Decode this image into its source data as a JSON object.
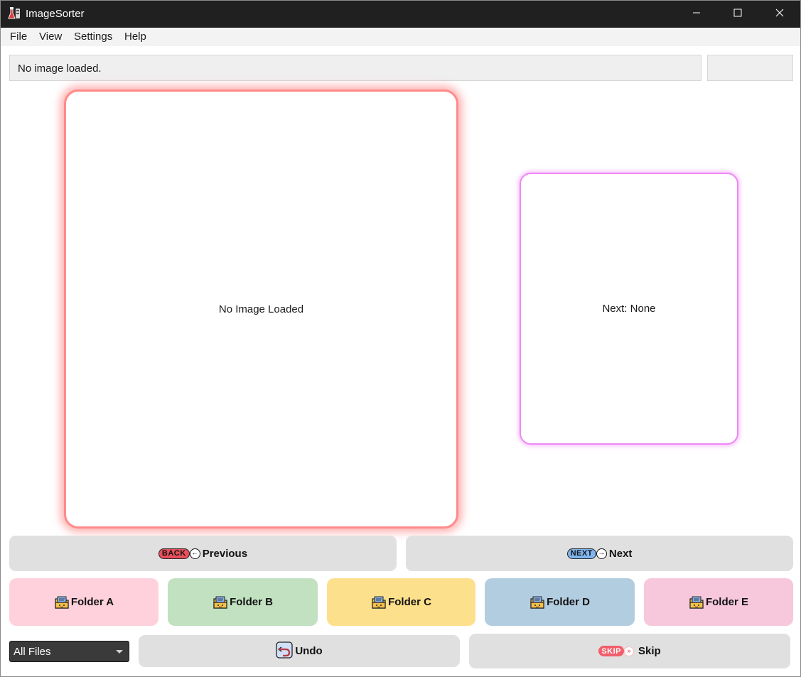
{
  "app": {
    "title": "ImageSorter",
    "icon": "lab-flask-icon"
  },
  "window_controls": {
    "minimize_icon": "minimize-icon",
    "maximize_icon": "maximize-icon",
    "close_icon": "close-icon"
  },
  "menu": {
    "items": [
      "File",
      "View",
      "Settings",
      "Help"
    ]
  },
  "status": {
    "message": "No image loaded.",
    "side_value": ""
  },
  "preview": {
    "main_text": "No Image Loaded",
    "next_text": "Next: None",
    "main_border_color": "#ff8a8a",
    "next_border_color": "#ee88f5"
  },
  "navigation": {
    "previous": {
      "badge": "BACK",
      "label": "Previous",
      "badge_color": "#e8505b"
    },
    "next": {
      "badge": "NEXT",
      "label": "Next",
      "badge_color": "#7fb6ef"
    }
  },
  "folders": [
    {
      "label": "Folder A",
      "color": "#ffd1dc"
    },
    {
      "label": "Folder B",
      "color": "#c1e1c1"
    },
    {
      "label": "Folder C",
      "color": "#fde08c"
    },
    {
      "label": "Folder D",
      "color": "#b3cde0"
    },
    {
      "label": "Folder E",
      "color": "#f7c8dc"
    }
  ],
  "filter": {
    "selected": "All Files"
  },
  "actions": {
    "undo": {
      "label": "Undo",
      "icon": "undo-arrow-icon"
    },
    "skip": {
      "label": "Skip",
      "badge": "SKIP",
      "badge_color": "#f25e6a"
    }
  }
}
